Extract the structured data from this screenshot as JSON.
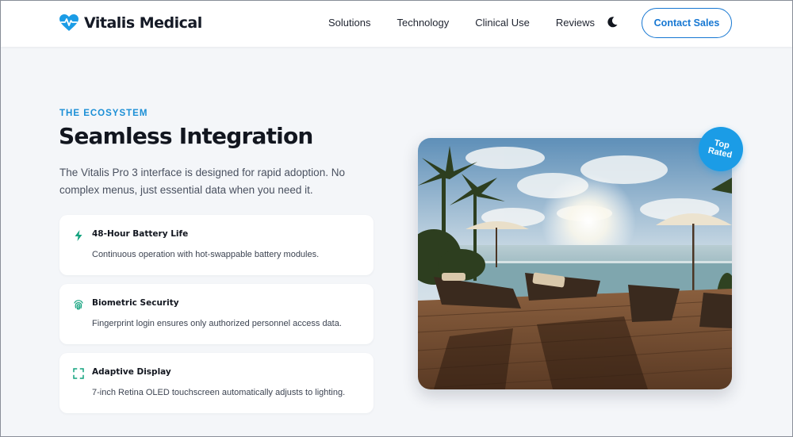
{
  "brand": {
    "name": "Vitalis Medical",
    "icon": "heart-pulse-icon",
    "color": "#1b9ce6"
  },
  "nav": {
    "items": [
      "Solutions",
      "Technology",
      "Clinical Use",
      "Reviews"
    ],
    "theme_icon": "moon-icon",
    "cta": "Contact Sales"
  },
  "section": {
    "eyebrow": "THE ECOSYSTEM",
    "title": "Seamless Integration",
    "description": "The Vitalis Pro 3 interface is designed for rapid adoption. No complex menus, just essential data when you need it."
  },
  "features": [
    {
      "icon": "lightning-bolt-icon",
      "title": "48-Hour Battery Life",
      "text": "Continuous operation with hot-swappable battery modules."
    },
    {
      "icon": "fingerprint-icon",
      "title": "Biometric Security",
      "text": "Fingerprint login ensures only authorized personnel access data."
    },
    {
      "icon": "expand-icon",
      "title": "Adaptive Display",
      "text": "7-inch Retina OLED touchscreen automatically adjusts to lighting."
    }
  ],
  "badge": {
    "line1": "Top",
    "line2": "Rated"
  },
  "colors": {
    "accent": "#1677d2",
    "eyebrow": "#1b8fd6",
    "icon_teal": "#14a37f",
    "background": "#f4f6f9"
  }
}
